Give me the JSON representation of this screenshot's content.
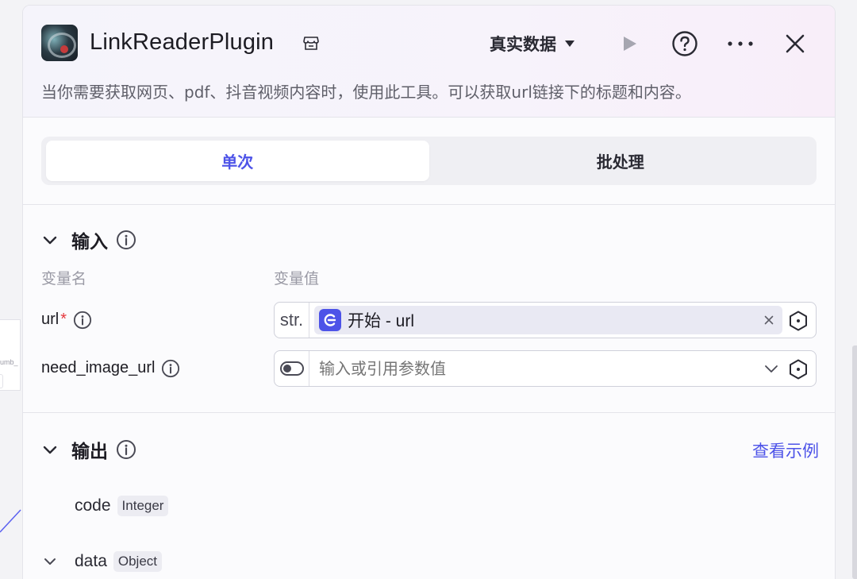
{
  "header": {
    "plugin_name": "LinkReaderPlugin",
    "data_mode": "真实数据",
    "description": "当你需要获取网页、pdf、抖音视频内容时，使用此工具。可以获取url链接下的标题和内容。"
  },
  "tabs": [
    {
      "label": "单次",
      "active": true
    },
    {
      "label": "批处理",
      "active": false
    }
  ],
  "input": {
    "title": "输入",
    "col_name": "变量名",
    "col_value": "变量值",
    "params": [
      {
        "name": "url",
        "required_mark": "*",
        "type_label": "str.",
        "ref_value": "开始 - url"
      },
      {
        "name": "need_image_url",
        "placeholder": "输入或引用参数值"
      }
    ]
  },
  "output": {
    "title": "输出",
    "example_link": "查看示例",
    "items": [
      {
        "name": "code",
        "type": "Integer"
      },
      {
        "name": "data",
        "type": "Object"
      }
    ]
  },
  "background": {
    "node_field_fragment": "umb_"
  },
  "colors": {
    "accent": "#4d53e8",
    "required": "#e5373c"
  }
}
